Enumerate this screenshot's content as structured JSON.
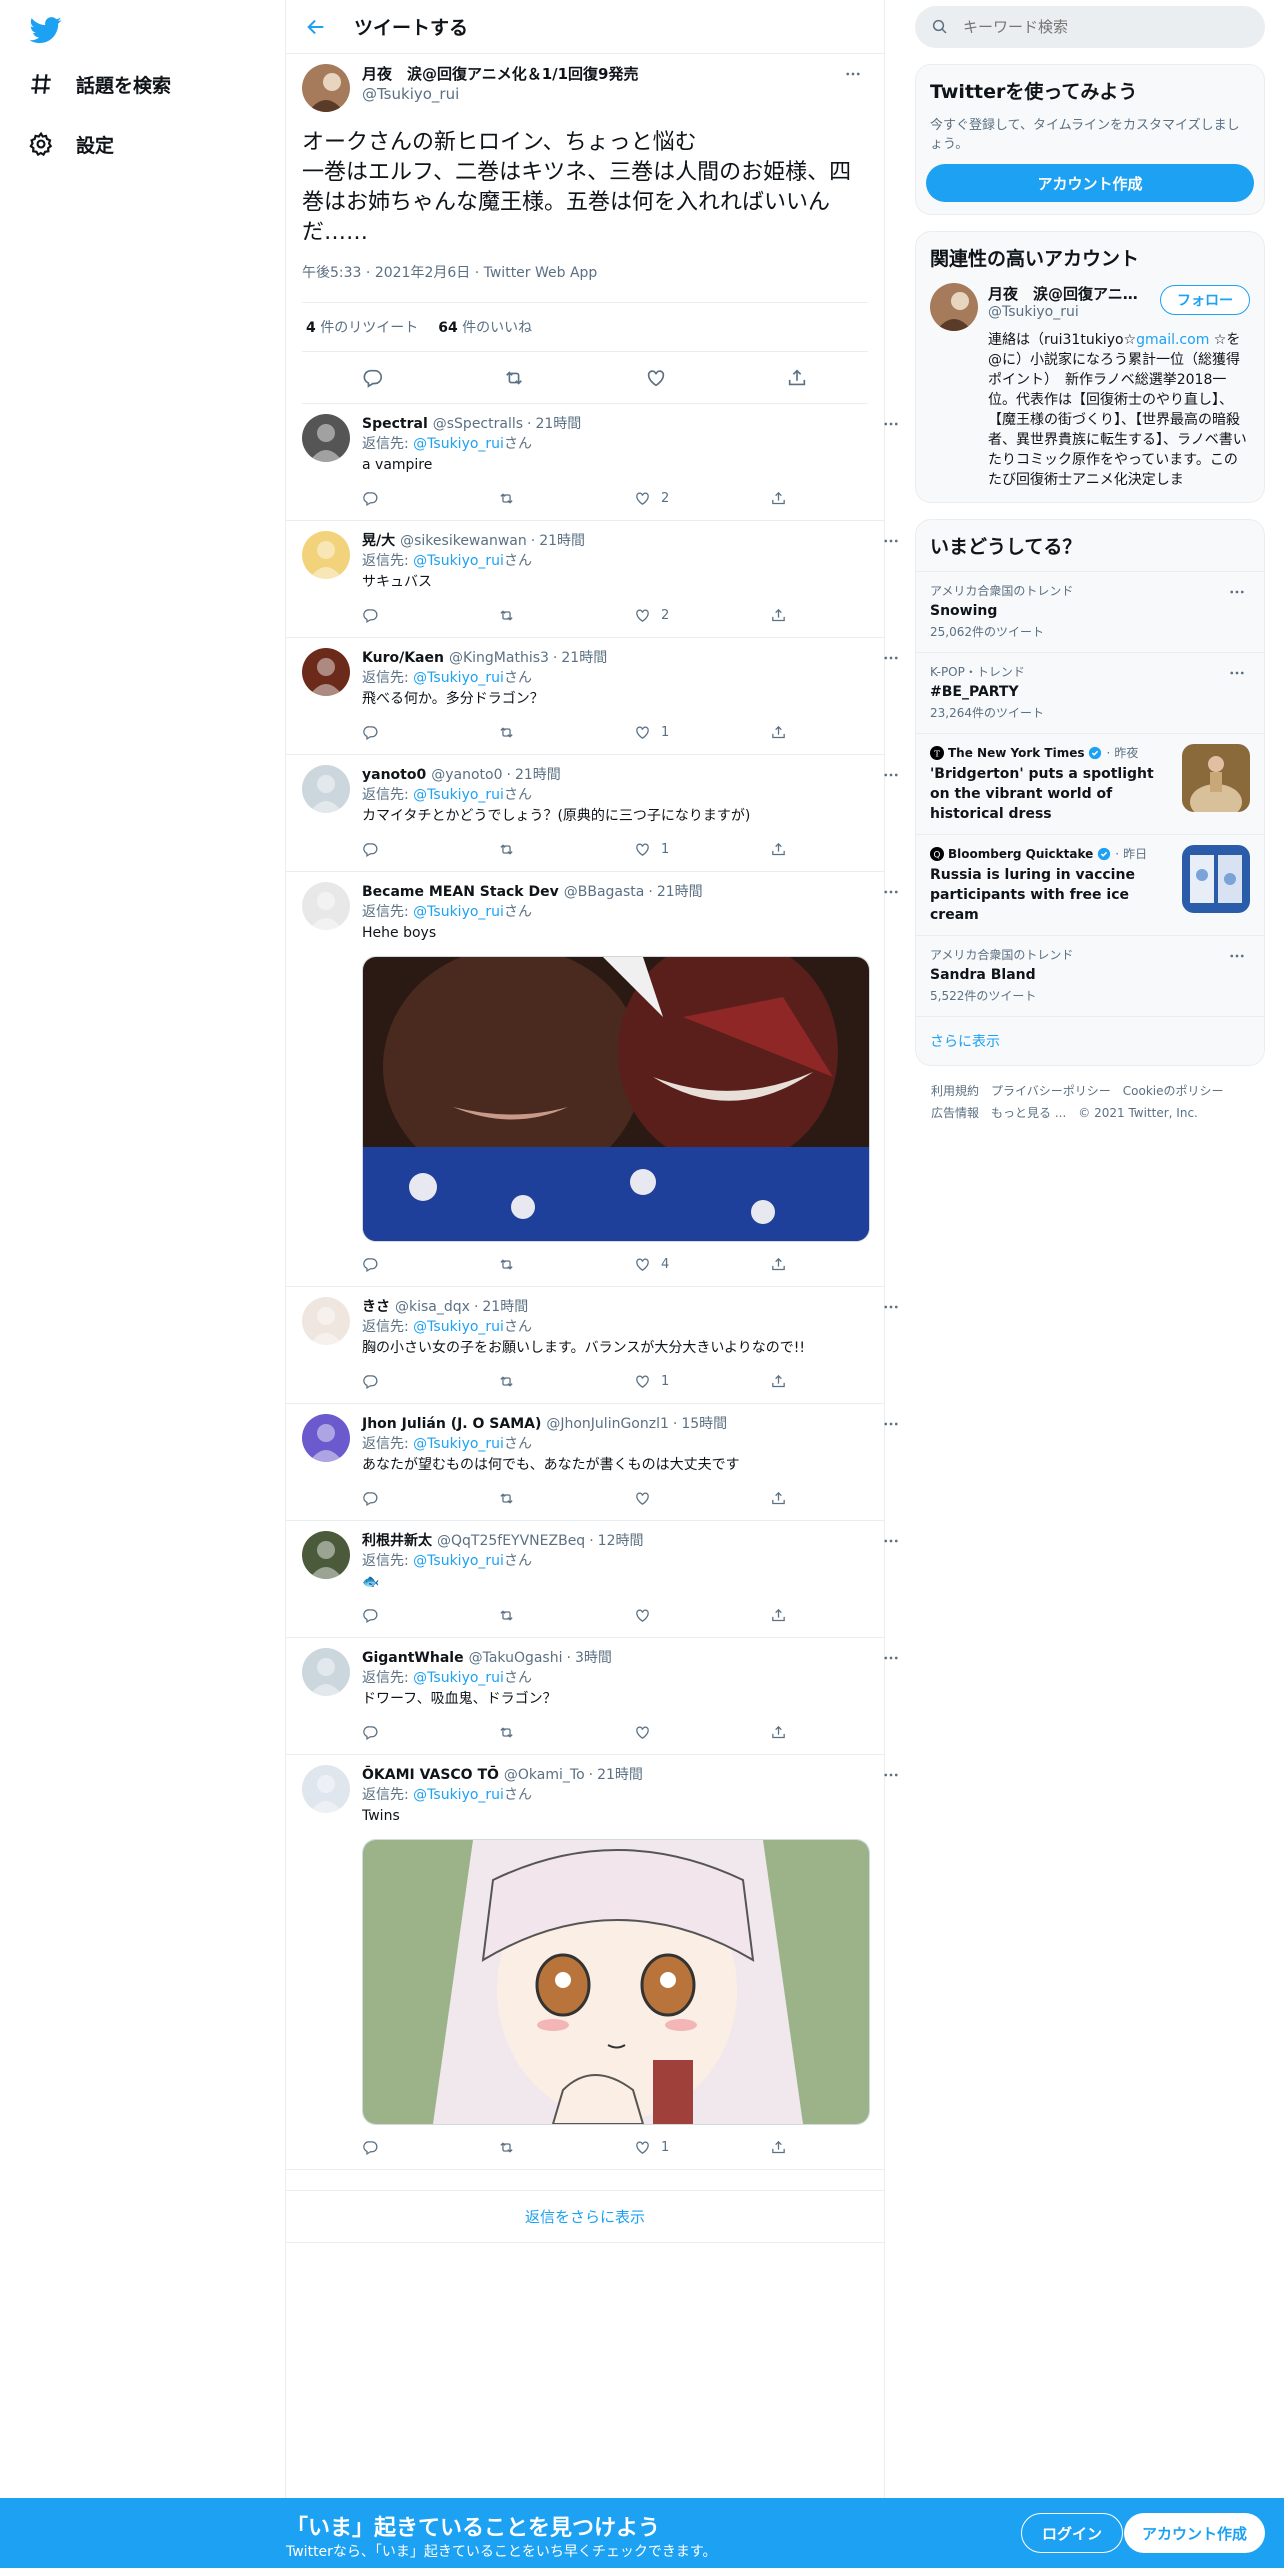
{
  "nav": {
    "explore_label": "話題を検索",
    "settings_label": "設定"
  },
  "header": {
    "title": "ツイートする"
  },
  "main_tweet": {
    "name": "月夜　涙@回復アニメ化＆1/1回復9発売",
    "handle": "@Tsukiyo_rui",
    "text": "オークさんの新ヒロイン、ちょっと悩む\n一巻はエルフ、二巻はキツネ、三巻は人間のお姫様、四巻はお姉ちゃんな魔王様。五巻は何を入れればいいんだ……",
    "time": "午後5:33",
    "date": "2021年2月6日",
    "client": "Twitter Web App",
    "retweets": "4",
    "retweets_label": "件のリツイート",
    "likes": "64",
    "likes_label": "件のいいね"
  },
  "replying_prefix": "返信先: ",
  "replying_handle": "@Tsukiyo_rui",
  "replying_suffix": "さん",
  "replies": [
    {
      "name": "Spectral",
      "handle": "@sSpectralls",
      "time": "21時間",
      "text": "a vampire",
      "likes": "2",
      "avatar": "#555"
    },
    {
      "name": "晃/大",
      "handle": "@sikesikewanwan",
      "time": "21時間",
      "text": "サキュバス",
      "likes": "2",
      "avatar": "#f2d27a"
    },
    {
      "name": "Kuro/Kaen",
      "handle": "@KingMathis3",
      "time": "21時間",
      "text": "飛べる何か。多分ドラゴン？",
      "likes": "1",
      "avatar": "#6b2a1a"
    },
    {
      "name": "yanoto0",
      "handle": "@yanoto0",
      "time": "21時間",
      "text": "カマイタチとかどうでしょう？(原典的に三つ子になりますが)",
      "likes": "1",
      "avatar": "#ccd6dd"
    },
    {
      "name": "Became MEAN Stack Dev",
      "handle": "@BBagasta",
      "time": "21時間",
      "text": "Hehe boys",
      "likes": "4",
      "avatar": "#e8e8e8"
    },
    {
      "name": "きさ",
      "handle": "@kisa_dqx",
      "time": "21時間",
      "text": "胸の小さい女の子をお願いします。バランスが大分大きいよりなので!!",
      "likes": "1",
      "avatar": "#f0e6e0"
    },
    {
      "name": "Jhon Julián (J. O SAMA)",
      "handle": "@JhonJulinGonzl1",
      "time": "15時間",
      "text": "あなたが望むものは何でも、あなたが書くものは大丈夫です",
      "likes": "",
      "avatar": "#6a5acd"
    },
    {
      "name": "利根井新太",
      "handle": "@QqT25fEYVNEZBeq",
      "time": "12時間",
      "text": "🐟",
      "likes": "",
      "avatar": "#4a5a3a"
    },
    {
      "name": "GigantWhale",
      "handle": "@TakuOgashi",
      "time": "3時間",
      "text": "ドワーフ、吸血鬼、ドラゴン？",
      "likes": "",
      "avatar": "#ccd6dd"
    },
    {
      "name": "ŌKAMI VASCO TŌ",
      "handle": "@Okami_To",
      "time": "21時間",
      "text": "Twins",
      "likes": "1",
      "avatar": "#dfe6ee"
    }
  ],
  "show_more_replies": "返信をさらに表示",
  "right": {
    "search_placeholder": "キーワード検索",
    "signup_title": "Twitterを使ってみよう",
    "signup_sub": "今すぐ登録して、タイムラインをカスタマイズしましょう。",
    "signup_button": "アカウント作成",
    "relevant_title": "関連性の高いアカウント",
    "relevant": {
      "name": "月夜　涙@回復アニ...",
      "handle": "@Tsukiyo_rui",
      "follow": "フォロー",
      "bio_pre": "連絡は（rui31tukiyo☆",
      "bio_link": "gmail.com",
      "bio_post": " ☆を@に）小説家になろう累計一位（総獲得ポイント）　新作ラノベ総選挙2018一位。代表作は【回復術士のやり直し】、【魔王様の街づくり】、【世界最高の暗殺者、異世界貴族に転生する】、ラノベ書いたりコミック原作をやっています。このたび回復術士アニメ化決定しま"
    },
    "trends_title": "いまどうしてる？",
    "trends": [
      {
        "context": "アメリカ合衆国のトレンド",
        "name": "Snowing",
        "count": "25,062件のツイート"
      },
      {
        "context": "K-POP・トレンド",
        "name": "#BE_PARTY",
        "count": "23,264件のツイート"
      }
    ],
    "news": [
      {
        "source": "The New York Times",
        "time": "昨夜",
        "title": "'Bridgerton' puts a spotlight on the vibrant world of historical dress"
      },
      {
        "source": "Bloomberg Quicktake",
        "time": "昨日",
        "title": "Russia is luring in vaccine participants with free ice cream"
      }
    ],
    "trend3": {
      "context": "アメリカ合衆国のトレンド",
      "name": "Sandra Bland",
      "count": "5,522件のツイート"
    },
    "show_more": "さらに表示",
    "footer": [
      "利用規約",
      "プライバシーポリシー",
      "Cookieのポリシー",
      "広告情報",
      "もっと見る ...",
      "© 2021 Twitter, Inc."
    ]
  },
  "bottom": {
    "title": "「いま」起きていることを見つけよう",
    "sub": "Twitterなら、「いま」起きていることをいち早くチェックできます。",
    "login": "ログイン",
    "signup": "アカウント作成"
  },
  "colors": {
    "accent": "#1da1f2",
    "muted": "#5b7083",
    "border": "#ebeef0"
  }
}
